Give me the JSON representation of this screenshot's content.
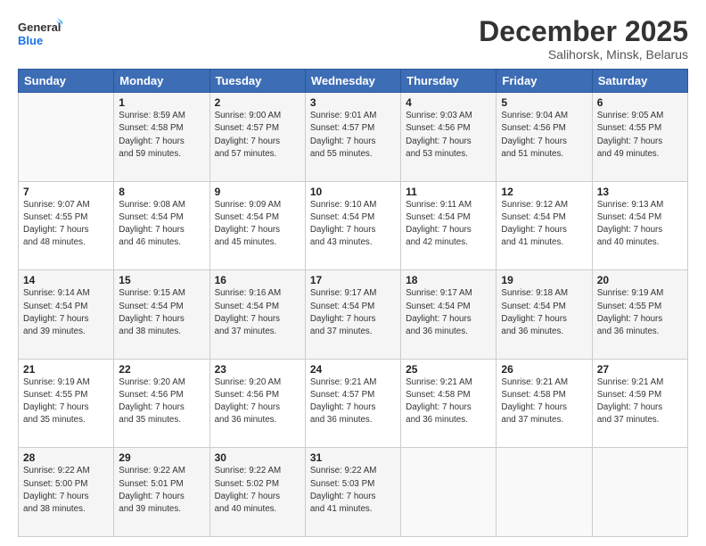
{
  "logo": {
    "line1": "General",
    "line2": "Blue"
  },
  "title": "December 2025",
  "subtitle": "Salihorsk, Minsk, Belarus",
  "weekdays": [
    "Sunday",
    "Monday",
    "Tuesday",
    "Wednesday",
    "Thursday",
    "Friday",
    "Saturday"
  ],
  "weeks": [
    [
      {
        "day": "",
        "info": ""
      },
      {
        "day": "1",
        "info": "Sunrise: 8:59 AM\nSunset: 4:58 PM\nDaylight: 7 hours\nand 59 minutes."
      },
      {
        "day": "2",
        "info": "Sunrise: 9:00 AM\nSunset: 4:57 PM\nDaylight: 7 hours\nand 57 minutes."
      },
      {
        "day": "3",
        "info": "Sunrise: 9:01 AM\nSunset: 4:57 PM\nDaylight: 7 hours\nand 55 minutes."
      },
      {
        "day": "4",
        "info": "Sunrise: 9:03 AM\nSunset: 4:56 PM\nDaylight: 7 hours\nand 53 minutes."
      },
      {
        "day": "5",
        "info": "Sunrise: 9:04 AM\nSunset: 4:56 PM\nDaylight: 7 hours\nand 51 minutes."
      },
      {
        "day": "6",
        "info": "Sunrise: 9:05 AM\nSunset: 4:55 PM\nDaylight: 7 hours\nand 49 minutes."
      }
    ],
    [
      {
        "day": "7",
        "info": "Sunrise: 9:07 AM\nSunset: 4:55 PM\nDaylight: 7 hours\nand 48 minutes."
      },
      {
        "day": "8",
        "info": "Sunrise: 9:08 AM\nSunset: 4:54 PM\nDaylight: 7 hours\nand 46 minutes."
      },
      {
        "day": "9",
        "info": "Sunrise: 9:09 AM\nSunset: 4:54 PM\nDaylight: 7 hours\nand 45 minutes."
      },
      {
        "day": "10",
        "info": "Sunrise: 9:10 AM\nSunset: 4:54 PM\nDaylight: 7 hours\nand 43 minutes."
      },
      {
        "day": "11",
        "info": "Sunrise: 9:11 AM\nSunset: 4:54 PM\nDaylight: 7 hours\nand 42 minutes."
      },
      {
        "day": "12",
        "info": "Sunrise: 9:12 AM\nSunset: 4:54 PM\nDaylight: 7 hours\nand 41 minutes."
      },
      {
        "day": "13",
        "info": "Sunrise: 9:13 AM\nSunset: 4:54 PM\nDaylight: 7 hours\nand 40 minutes."
      }
    ],
    [
      {
        "day": "14",
        "info": "Sunrise: 9:14 AM\nSunset: 4:54 PM\nDaylight: 7 hours\nand 39 minutes."
      },
      {
        "day": "15",
        "info": "Sunrise: 9:15 AM\nSunset: 4:54 PM\nDaylight: 7 hours\nand 38 minutes."
      },
      {
        "day": "16",
        "info": "Sunrise: 9:16 AM\nSunset: 4:54 PM\nDaylight: 7 hours\nand 37 minutes."
      },
      {
        "day": "17",
        "info": "Sunrise: 9:17 AM\nSunset: 4:54 PM\nDaylight: 7 hours\nand 37 minutes."
      },
      {
        "day": "18",
        "info": "Sunrise: 9:17 AM\nSunset: 4:54 PM\nDaylight: 7 hours\nand 36 minutes."
      },
      {
        "day": "19",
        "info": "Sunrise: 9:18 AM\nSunset: 4:54 PM\nDaylight: 7 hours\nand 36 minutes."
      },
      {
        "day": "20",
        "info": "Sunrise: 9:19 AM\nSunset: 4:55 PM\nDaylight: 7 hours\nand 36 minutes."
      }
    ],
    [
      {
        "day": "21",
        "info": "Sunrise: 9:19 AM\nSunset: 4:55 PM\nDaylight: 7 hours\nand 35 minutes."
      },
      {
        "day": "22",
        "info": "Sunrise: 9:20 AM\nSunset: 4:56 PM\nDaylight: 7 hours\nand 35 minutes."
      },
      {
        "day": "23",
        "info": "Sunrise: 9:20 AM\nSunset: 4:56 PM\nDaylight: 7 hours\nand 36 minutes."
      },
      {
        "day": "24",
        "info": "Sunrise: 9:21 AM\nSunset: 4:57 PM\nDaylight: 7 hours\nand 36 minutes."
      },
      {
        "day": "25",
        "info": "Sunrise: 9:21 AM\nSunset: 4:58 PM\nDaylight: 7 hours\nand 36 minutes."
      },
      {
        "day": "26",
        "info": "Sunrise: 9:21 AM\nSunset: 4:58 PM\nDaylight: 7 hours\nand 37 minutes."
      },
      {
        "day": "27",
        "info": "Sunrise: 9:21 AM\nSunset: 4:59 PM\nDaylight: 7 hours\nand 37 minutes."
      }
    ],
    [
      {
        "day": "28",
        "info": "Sunrise: 9:22 AM\nSunset: 5:00 PM\nDaylight: 7 hours\nand 38 minutes."
      },
      {
        "day": "29",
        "info": "Sunrise: 9:22 AM\nSunset: 5:01 PM\nDaylight: 7 hours\nand 39 minutes."
      },
      {
        "day": "30",
        "info": "Sunrise: 9:22 AM\nSunset: 5:02 PM\nDaylight: 7 hours\nand 40 minutes."
      },
      {
        "day": "31",
        "info": "Sunrise: 9:22 AM\nSunset: 5:03 PM\nDaylight: 7 hours\nand 41 minutes."
      },
      {
        "day": "",
        "info": ""
      },
      {
        "day": "",
        "info": ""
      },
      {
        "day": "",
        "info": ""
      }
    ]
  ]
}
